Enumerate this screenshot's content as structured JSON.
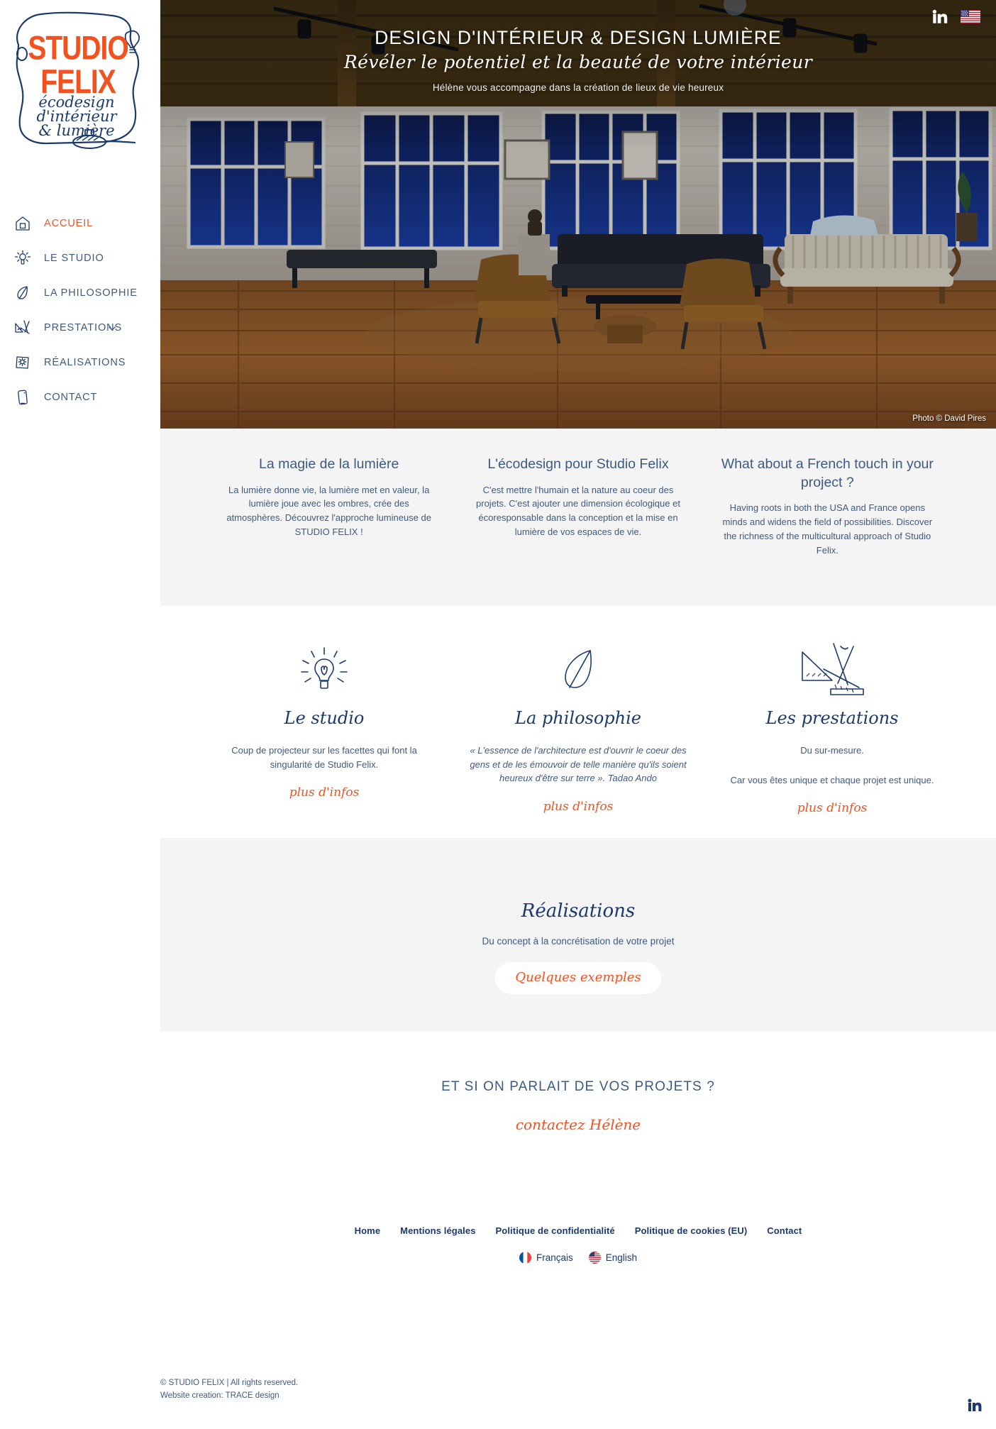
{
  "brand": {
    "name_line1": "STUDIO",
    "name_line2": "FELIX",
    "tagline_line1": "écodesign",
    "tagline_line2": "d'intérieur",
    "tagline_line3": "& lumière",
    "accent_color": "#f4511e",
    "navy_color": "#1b3a6b"
  },
  "sidebar": {
    "items": [
      {
        "label": "ACCUEIL",
        "icon": "house-icon",
        "active": true,
        "has_chevron": false
      },
      {
        "label": "LE STUDIO",
        "icon": "lightbulb-icon",
        "active": false,
        "has_chevron": false
      },
      {
        "label": "LA PHILOSOPHIE",
        "icon": "leaf-icon",
        "active": false,
        "has_chevron": false
      },
      {
        "label": "PRESTATIONS",
        "icon": "drafting-tools-icon",
        "active": false,
        "has_chevron": true
      },
      {
        "label": "RÉALISATIONS",
        "icon": "framed-plan-icon",
        "active": false,
        "has_chevron": false
      },
      {
        "label": "CONTACT",
        "icon": "phone-icon",
        "active": false,
        "has_chevron": false
      }
    ]
  },
  "hero": {
    "title": "DESIGN D'INTÉRIEUR & DESIGN LUMIÈRE",
    "script_subtitle": "Révéler le potentiel et la beauté de votre intérieur",
    "tagline": "Hélène vous accompagne dans la création de lieux de vie heureux",
    "photo_credit": "Photo © David Pires",
    "linkedin_icon": "linkedin-icon",
    "flag_icon": "us-flag-icon"
  },
  "intro": {
    "columns": [
      {
        "title": "La magie de la lumière",
        "body": "La lumière donne vie, la lumière met en valeur, la lumière joue avec les ombres, crée des atmosphères. Découvrez l'approche lumineuse de STUDIO FELIX !"
      },
      {
        "title": "L'écodesign pour Studio Felix",
        "body": "C'est mettre l'humain et la nature au coeur des projets. C'est ajouter une dimension écologique et écoresponsable dans la conception et la mise en lumière de vos espaces de vie."
      },
      {
        "title": "What about a French touch in your project ?",
        "body": "Having roots in both the USA and France opens minds and widens the field of possibilities. Discover the richness of the multicultural approach of Studio Felix."
      }
    ]
  },
  "features": {
    "columns": [
      {
        "icon": "lightbulb-rays-icon",
        "title": "Le studio",
        "body": "Coup de projecteur sur les facettes qui font la singularité de Studio Felix.",
        "body2": "",
        "link": "plus d'infos"
      },
      {
        "icon": "leaf-icon",
        "title": "La philosophie",
        "body": "« L'essence de l'architecture est d'ouvrir le coeur des gens et de les émouvoir de telle manière qu'ils soient heureux d'être sur terre ». Tadao Ando",
        "body2": "",
        "link": "plus d'infos"
      },
      {
        "icon": "drafting-tools-icon",
        "title": "Les prestations",
        "body": "Du sur-mesure.",
        "body2": "Car vous êtes unique et chaque projet est unique.",
        "link": "plus d'infos"
      }
    ]
  },
  "realisations": {
    "title": "Réalisations",
    "subtitle": "Du concept à la concrétisation de votre projet",
    "button": "Quelques exemples"
  },
  "cta": {
    "heading": "ET SI ON PARLAIT DE VOS PROJETS ?",
    "link": "contactez Hélène"
  },
  "footer": {
    "links": [
      "Home",
      "Mentions légales",
      "Politique de confidentialité",
      "Politique de cookies (EU)",
      "Contact"
    ],
    "languages": [
      {
        "label": "Français",
        "flag": "fr-flag-icon"
      },
      {
        "label": "English",
        "flag": "us-flag-icon"
      }
    ],
    "copyright": "© STUDIO FELIX | All rights reserved.",
    "credit": "Website creation: TRACE design",
    "linkedin_icon": "linkedin-icon"
  }
}
